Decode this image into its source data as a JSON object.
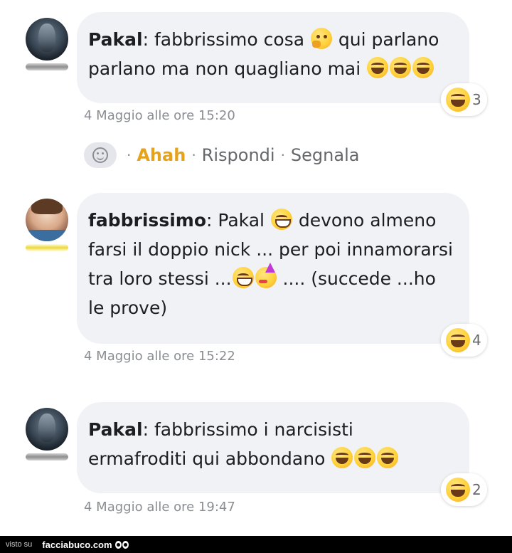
{
  "comments": [
    {
      "author": "Pakal",
      "separator": ":",
      "text_parts": [
        " fabbrissimo cosa ",
        " qui parlano parlano ma non quagliano mai "
      ],
      "emojis": [
        "thinking-face",
        "laughing-face",
        "laughing-face",
        "laughing-face"
      ],
      "reaction_count": "3",
      "timestamp": "4 Maggio alle ore 15:20"
    },
    {
      "author": "fabbrissimo",
      "separator": ":",
      "text_parts": [
        " Pakal ",
        " devono almeno farsi il doppio nick ... per poi innamorarsi tra loro stessi ...",
        " .... (succede ...ho le prove)"
      ],
      "emojis": [
        "grinning-face",
        "grinning-face",
        "partying-face"
      ],
      "reaction_count": "4",
      "timestamp": "4 Maggio alle ore 15:22"
    },
    {
      "author": "Pakal",
      "separator": ":",
      "text_parts": [
        " fabbrissimo i narcisisti ermafroditi qui abbondano "
      ],
      "emojis": [
        "laughing-face",
        "laughing-face",
        "laughing-face"
      ],
      "reaction_count": "2",
      "timestamp": "4 Maggio alle ore 19:47"
    }
  ],
  "actions": {
    "separator": "·",
    "reaction_label": "Ahah",
    "reply_label": "Rispondi",
    "report_label": "Segnala"
  },
  "footer": {
    "prefix": "visto su",
    "brand": "facciabuco.com"
  },
  "colors": {
    "bubble": "#f0f2f5",
    "ahah": "#e6a218",
    "meta": "#8a8d91",
    "footer": "#000000"
  }
}
